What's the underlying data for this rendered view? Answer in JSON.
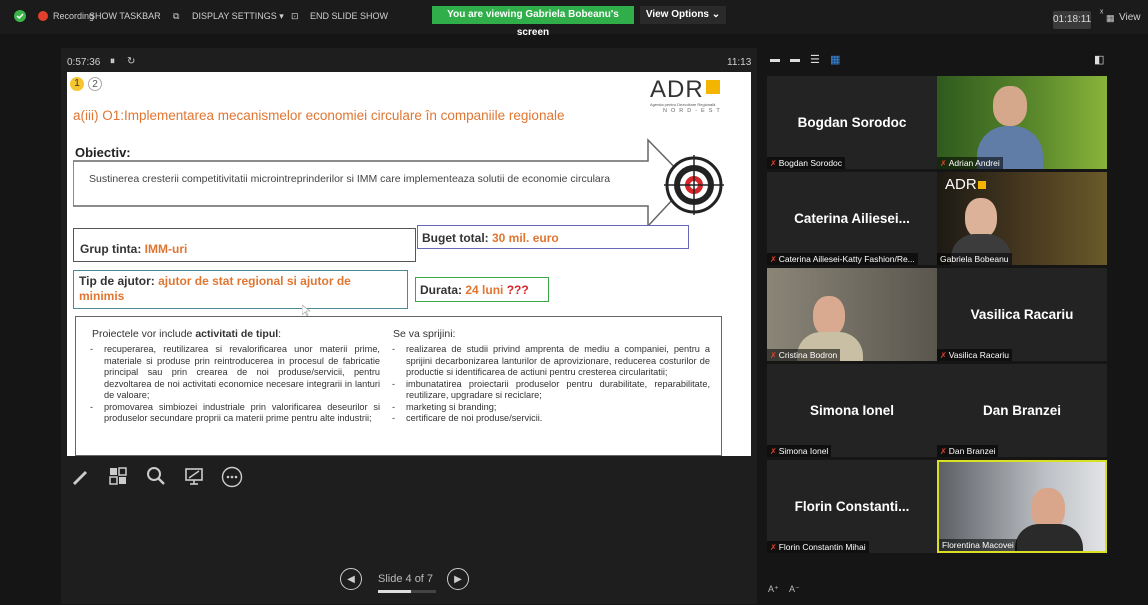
{
  "topbar": {
    "recording": "Recording",
    "show_taskbar": "SHOW TASKBAR",
    "display_settings": "DISPLAY SETTINGS ▾",
    "end_slide_show": "END SLIDE SHOW",
    "banner": "You are viewing Gabriela Bobeanu's screen",
    "view_options": "View Options ⌄",
    "elapsed": "01:18:11",
    "view": "View"
  },
  "presenter": {
    "timer": "0:57:36",
    "clock": "11:13",
    "slide_position": "Slide 4 of 7",
    "progress_fraction": 0.57
  },
  "slide": {
    "badge1": "1",
    "badge2": "2",
    "title": "a(iii) O1:Implementarea mecanismelor economiei circulare în companiile regionale",
    "logo": "ADR",
    "logo_sub": "Agenția pentru Dezvoltare Regională",
    "logo_region": "NORD-EST",
    "objective_label": "Obiectiv:",
    "objective_text": "Sustinerea cresterii competitivitatii microintreprinderilor si IMM care implementeaza solutii de economie circulara",
    "group_label": "Grup tinta: ",
    "group_value": "IMM-uri",
    "budget_label": "Buget total: ",
    "budget_value": "30 mil. euro",
    "aid_label": "Tip de ajutor: ",
    "aid_value": "ajutor de stat regional si ajutor de minimis",
    "duration_label": "Durata: ",
    "duration_value": "24 luni",
    "duration_marks": "???",
    "activities_intro": "Proiectele vor include ",
    "activities_bold": "activitati de tipul",
    "activities_colon": ":",
    "left_items": [
      "recuperarea, reutilizarea si revalorificarea unor materii prime, materiale si produse prin reintroducerea in procesul de fabricatie principal sau prin crearea de noi produse/servicii, pentru dezvoltarea de noi activitati economice necesare integrarii in lanturi de valoare;",
      "promovarea simbiozei industriale prin valorificarea deseurilor si produselor secundare proprii ca materii prime pentru alte industrii;"
    ],
    "support_intro": "Se va sprijini:",
    "right_items": [
      "realizarea de studii privind amprenta de mediu a companiei, pentru a sprijini decarbonizarea lanturilor de aprovizionare, reducerea costurilor de productie si identificarea de actiuni pentru cresterea circularitatii;",
      "imbunatatirea proiectarii produselor pentru durabilitate, reparabilitate, reutilizare, upgradare si reciclare;",
      "marketing si branding;",
      "certificare de noi produse/servicii."
    ]
  },
  "gallery": {
    "tiles": [
      {
        "name": "Bogdan Sorodoc",
        "label": "Bogdan Sorodoc",
        "video": false
      },
      {
        "name": "",
        "label": "Adrian Andrei",
        "video": true
      },
      {
        "name": "Caterina  Ailiesei...",
        "label": "Caterina Ailiesei-Katty Fashion/Re...",
        "video": false
      },
      {
        "name": "",
        "label": "Gabriela Bobeanu",
        "video": true
      },
      {
        "name": "",
        "label": "Cristina Bodron",
        "video": true
      },
      {
        "name": "Vasilica Racariu",
        "label": "Vasilica Racariu",
        "video": false
      },
      {
        "name": "Simona Ionel",
        "label": "Simona Ionel",
        "video": false
      },
      {
        "name": "Dan Branzei",
        "label": "Dan Branzei",
        "video": false
      },
      {
        "name": "Florin  Constanti...",
        "label": "Florin Constantin Mihai",
        "video": false
      },
      {
        "name": "",
        "label": "Florentina Macovei",
        "video": true
      }
    ],
    "tile2_logo": "ADR"
  },
  "colors": {
    "accent_orange": "#e07632",
    "banner_green": "#2fae4a",
    "active_speaker": "#d9e021",
    "mic_muted": "#e2402d"
  }
}
